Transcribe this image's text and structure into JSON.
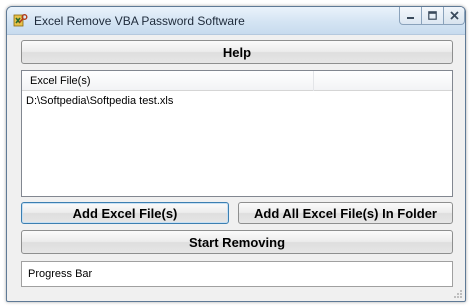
{
  "window": {
    "title": "Excel Remove VBA Password Software",
    "icon": "excel-key-icon"
  },
  "buttons": {
    "help": "Help",
    "add_files": "Add Excel File(s)",
    "add_folder": "Add All Excel File(s) In Folder",
    "start": "Start Removing"
  },
  "file_list": {
    "columns": [
      "Excel File(s)",
      ""
    ],
    "rows": [
      "D:\\Softpedia\\Softpedia test.xls"
    ]
  },
  "progress": {
    "label": "Progress Bar",
    "value": 0
  },
  "colors": {
    "titlebar": "#d4e4f3",
    "window_bg": "#f0f0f0",
    "focus_border": "#3c7fb1"
  }
}
